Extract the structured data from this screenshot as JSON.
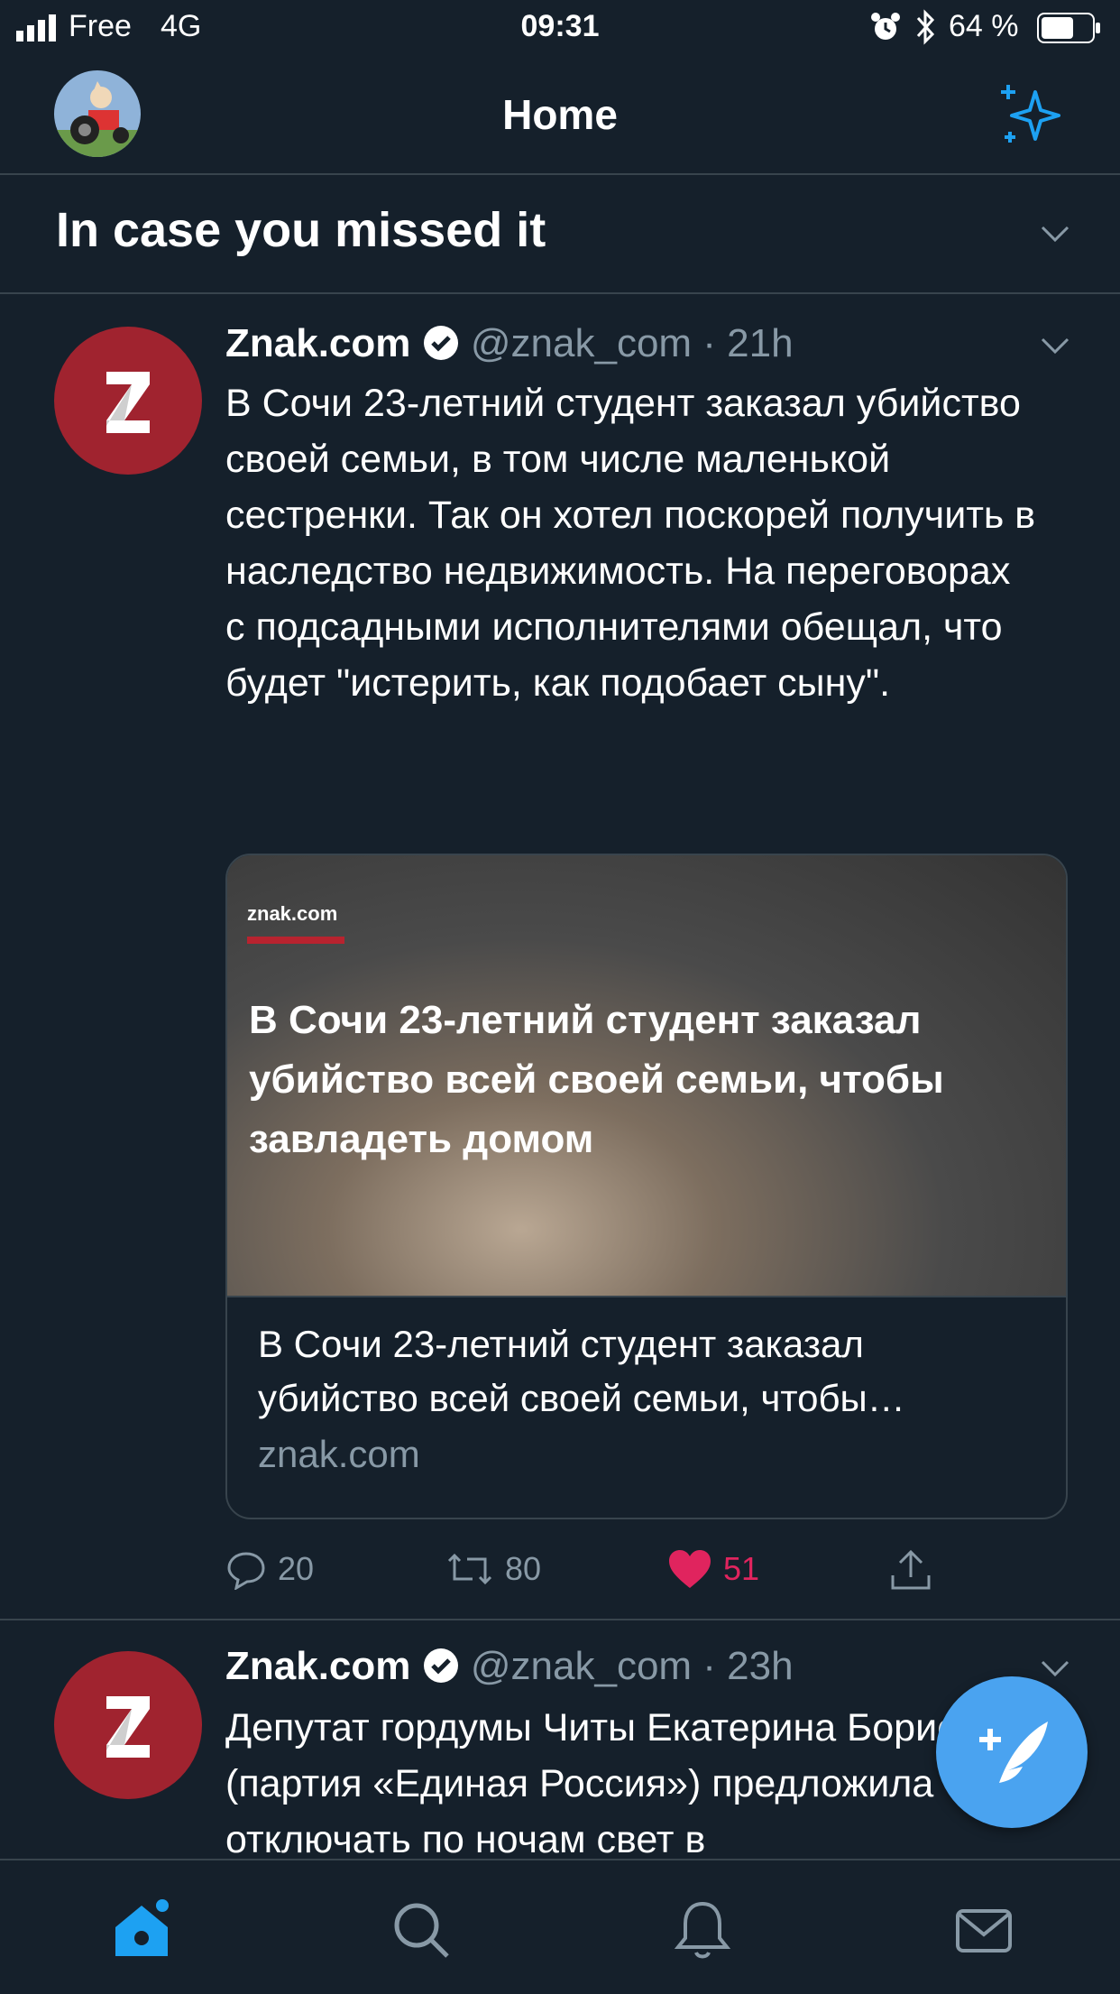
{
  "status_bar": {
    "carrier": "Free",
    "network": "4G",
    "time": "09:31",
    "battery": "64 %",
    "battery_level": 0.64
  },
  "nav": {
    "title": "Home",
    "avatar_icon": "tractor-avatar-icon",
    "action_icon": "sparkle-icon"
  },
  "section": {
    "title": "In case you missed it"
  },
  "tweets": [
    {
      "name": "Znak.com",
      "handle": "@znak_com",
      "time": "21h",
      "text": "В Сочи 23-летний студент заказал убийство своей семьи, в том числе маленькой сестренки. Так он хотел поскорей получить в наследство недвижимость. На переговорах с подсадными исполнителями обещал, что будет \"истерить, как подобает сыну\".",
      "card": {
        "logo": "znak.com",
        "image_headline": "В Сочи 23-летний студент заказал убийство всей своей семьи, чтобы завладеть домом",
        "title": "В Сочи 23-летний студент заказал убийство всей своей семьи, чтобы…",
        "domain": "znak.com"
      },
      "replies": "20",
      "retweets": "80",
      "likes": "51"
    },
    {
      "name": "Znak.com",
      "handle": "@znak_com",
      "time": "23h",
      "text": "Депутат гордумы Читы Екатерина Борисова (партия «Единая Россия») предложила отключать по ночам свет в"
    }
  ],
  "colors": {
    "background": "#15202b",
    "accent": "#1da1f2",
    "like": "#e0245e",
    "brand": "#a0232f",
    "muted": "#8899a6"
  }
}
